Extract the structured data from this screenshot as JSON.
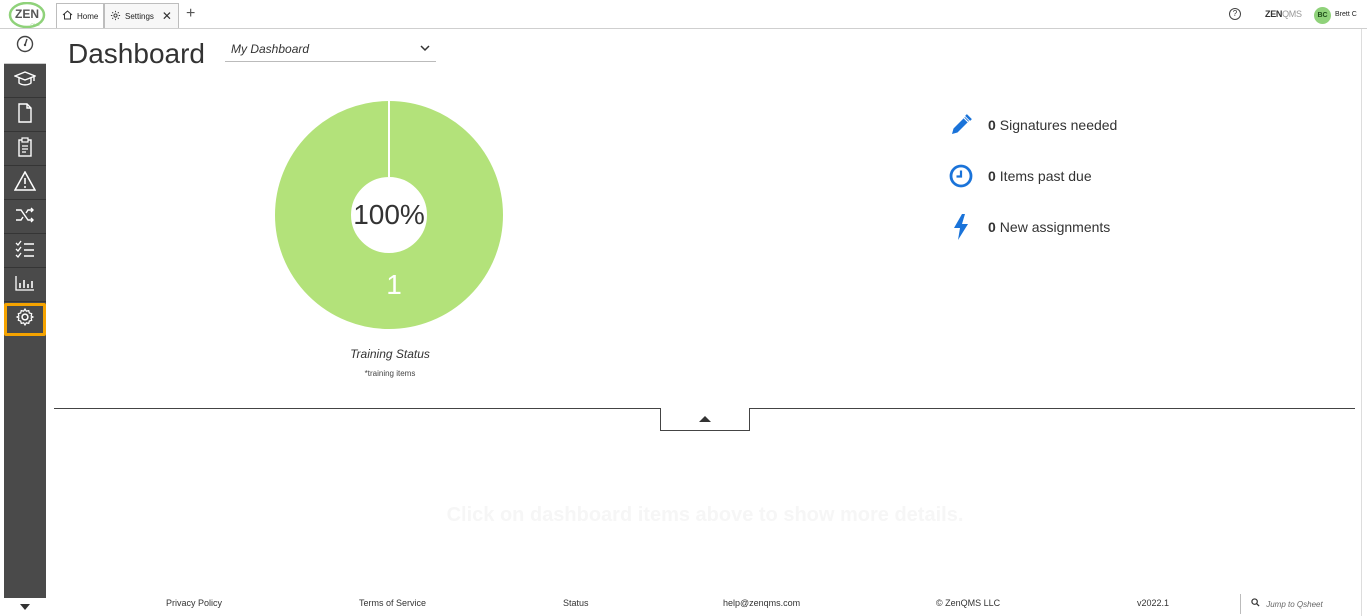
{
  "app": {
    "logo_text": "ZEN",
    "logo_sub": "QMS",
    "brand_primary": "ZEN",
    "brand_secondary": "QMS",
    "user_initials": "BC",
    "user_name": "Brett C"
  },
  "tabs": [
    {
      "label": "Home",
      "icon": "home-icon"
    },
    {
      "label": "Settings",
      "icon": "gear-icon",
      "close": "✕"
    }
  ],
  "new_tab_label": "+",
  "help_label": "?",
  "sidebar": {
    "items": [
      {
        "name": "dashboard",
        "icon": "gauge-icon"
      },
      {
        "name": "training",
        "icon": "graduation-cap-icon"
      },
      {
        "name": "documents",
        "icon": "document-icon"
      },
      {
        "name": "audits",
        "icon": "clipboard-icon"
      },
      {
        "name": "risks",
        "icon": "warning-icon"
      },
      {
        "name": "change-control",
        "icon": "shuffle-icon"
      },
      {
        "name": "tasks",
        "icon": "checklist-icon"
      },
      {
        "name": "reports",
        "icon": "bar-chart-icon"
      },
      {
        "name": "settings",
        "icon": "gear-icon",
        "selected": true
      }
    ],
    "expand_icon": "caret-down-icon"
  },
  "header": {
    "title": "Dashboard",
    "dashboard_select": "My Dashboard"
  },
  "training": {
    "percent_label": "100%",
    "count_label": "1",
    "percent_complete": 100,
    "caption": "Training Status",
    "sub_caption": "*training items",
    "color": "#b3e27a"
  },
  "stats": [
    {
      "count": "0",
      "label": "Signatures needed",
      "icon": "pencil-icon"
    },
    {
      "count": "0",
      "label": "Items past due",
      "icon": "clock-icon"
    },
    {
      "count": "0",
      "label": "New assignments",
      "icon": "lightning-icon"
    }
  ],
  "accent_color": "#1a73d9",
  "hint": "Click on dashboard items above to show more details.",
  "footer": {
    "privacy": "Privacy Policy",
    "terms": "Terms of Service",
    "status": "Status",
    "email": "help@zenqms.com",
    "copyright": "© ZenQMS LLC",
    "version": "v2022.1",
    "jump_placeholder": "Jump to Qsheet"
  }
}
